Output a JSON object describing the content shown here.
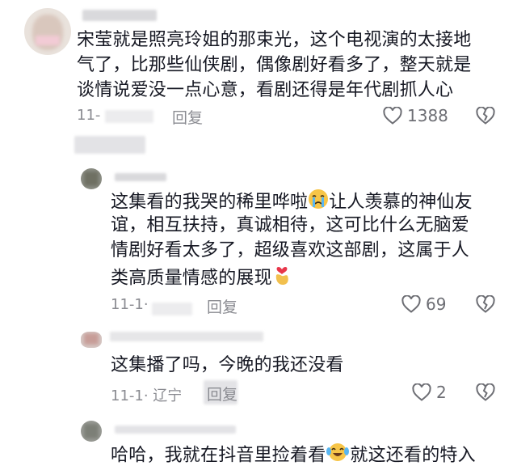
{
  "comments": [
    {
      "lines": [
        "宋莹就是照亮玲姐的那束光，这个电视演的太接地",
        "气了，比那些仙侠剧，偶像剧好看多了，整天就是",
        "谈情说爱没一点心意，看剧还得是年代剧抓人心"
      ],
      "date_prefix": "11-",
      "reply": "回复",
      "likes": "1388"
    },
    {
      "line1": "这集看的我哭的稀里哗啦",
      "line1b": "让人羡慕的神仙友",
      "lines_mid": [
        "谊，相互扶持，真诚相待，这可比什么无脑爱",
        "情剧好看太多了，超级喜欢这部剧，这属于人"
      ],
      "line_last": "类高质量情感的展现",
      "date_prefix": "11-1·",
      "reply": "回复",
      "likes": "69"
    },
    {
      "text": "这集播了吗，今晚的我还没看",
      "date": "11-1· 辽宁",
      "reply": "回复",
      "likes": "2"
    },
    {
      "text": "哈哈，我就在抖音里捡着看",
      "text_b": "就这还看的特入"
    }
  ],
  "icons": {
    "heart": "heart-icon",
    "dislike": "broken-heart-icon",
    "cry": "crying-emoji",
    "hand": "finger-heart-emoji",
    "laugh": "tears-of-joy-emoji"
  }
}
